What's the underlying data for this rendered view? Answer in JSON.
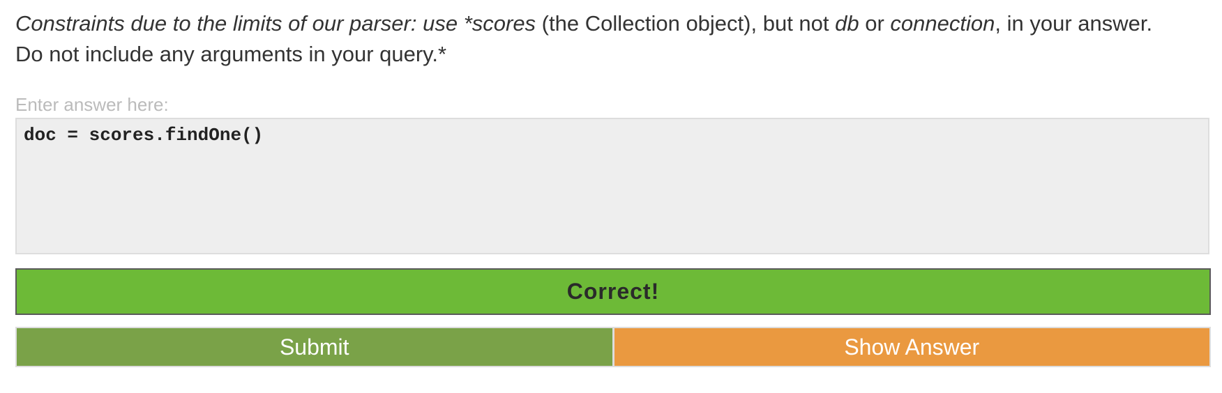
{
  "instructions": {
    "line1_italic_a": "Constraints due to the limits of our parser: use *scores",
    "line1_plain_a": " (the Collection object), but not ",
    "line1_italic_b": "db",
    "line1_plain_b": " or ",
    "line1_italic_c": "connection",
    "line1_plain_c": ", in your answer.",
    "line2": "Do not include any arguments in your query.*"
  },
  "answer": {
    "label": "Enter answer here:",
    "value": "doc = scores.findOne()"
  },
  "feedback": {
    "text": "Correct!",
    "color": "#6dba37"
  },
  "buttons": {
    "submit_label": "Submit",
    "submit_color": "#7aa248",
    "show_answer_label": "Show Answer",
    "show_answer_color": "#ea9940"
  }
}
